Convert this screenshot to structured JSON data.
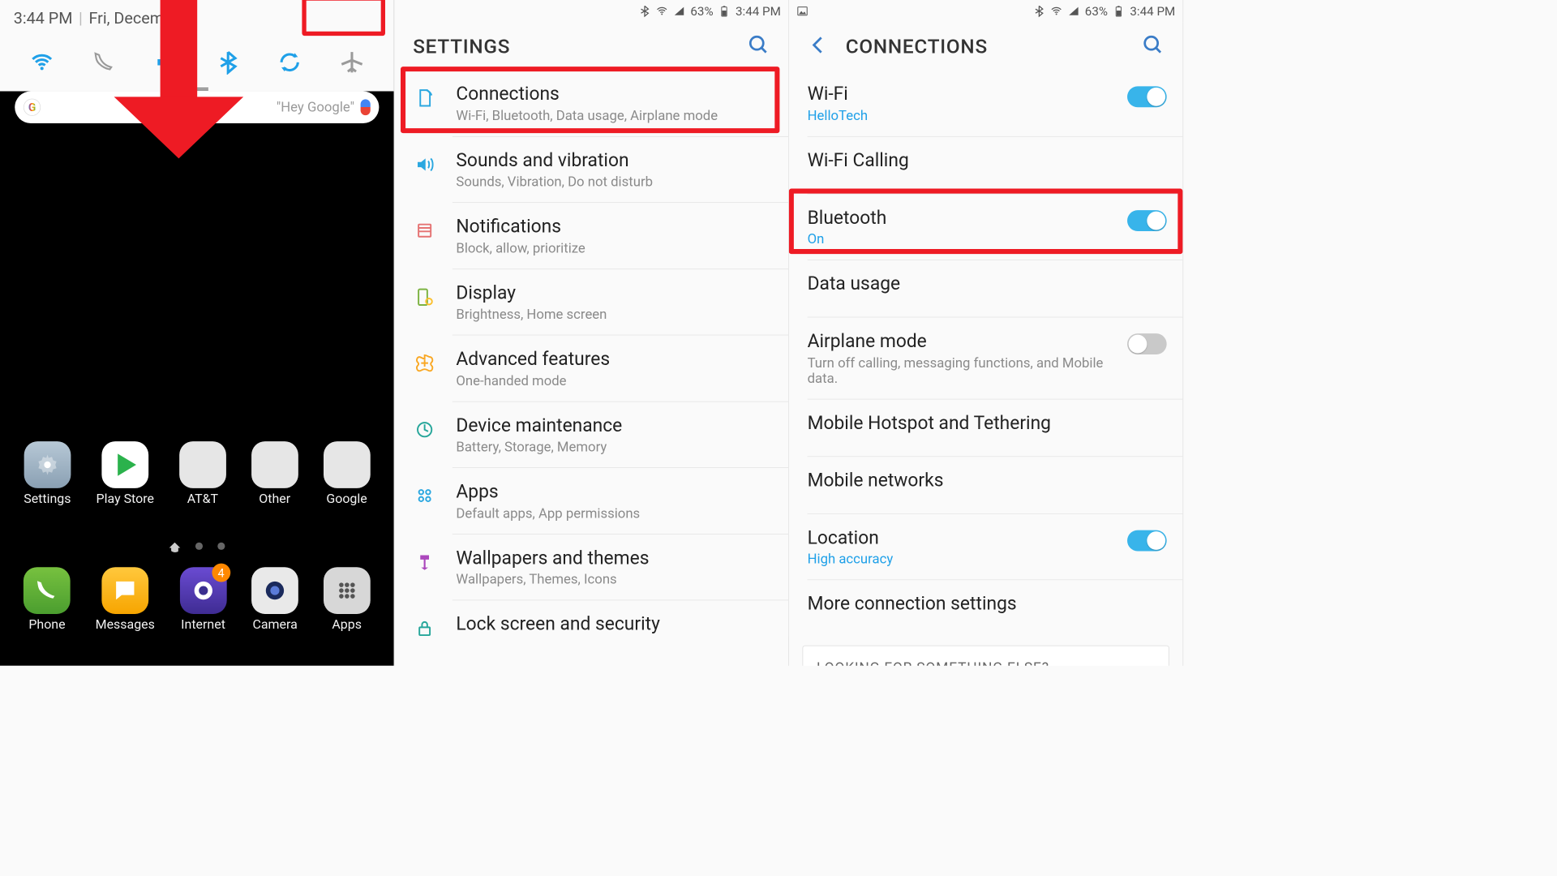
{
  "pane1": {
    "time": "3:44 PM",
    "date_prefix": "Fri, December",
    "search_hint": "\"Hey Google\"",
    "apps_row1": [
      {
        "label": "Settings"
      },
      {
        "label": "Play Store"
      },
      {
        "label": "AT&T"
      },
      {
        "label": "Other"
      },
      {
        "label": "Google"
      }
    ],
    "apps_row2": [
      {
        "label": "Phone"
      },
      {
        "label": "Messages"
      },
      {
        "label": "Internet",
        "badge": "4"
      },
      {
        "label": "Camera"
      },
      {
        "label": "Apps"
      }
    ]
  },
  "status": {
    "battery_pct": "63%",
    "time": "3:44 PM"
  },
  "settings": {
    "title": "SETTINGS",
    "items": [
      {
        "title": "Connections",
        "sub": "Wi-Fi, Bluetooth, Data usage, Airplane mode",
        "icon": "sim"
      },
      {
        "title": "Sounds and vibration",
        "sub": "Sounds, Vibration, Do not disturb",
        "icon": "sound"
      },
      {
        "title": "Notifications",
        "sub": "Block, allow, prioritize",
        "icon": "notif"
      },
      {
        "title": "Display",
        "sub": "Brightness, Home screen",
        "icon": "display"
      },
      {
        "title": "Advanced features",
        "sub": "One-handed mode",
        "icon": "adv"
      },
      {
        "title": "Device maintenance",
        "sub": "Battery, Storage, Memory",
        "icon": "maint"
      },
      {
        "title": "Apps",
        "sub": "Default apps, App permissions",
        "icon": "apps"
      },
      {
        "title": "Wallpapers and themes",
        "sub": "Wallpapers, Themes, Icons",
        "icon": "wall"
      },
      {
        "title": "Lock screen and security",
        "sub": "",
        "icon": "lock"
      }
    ]
  },
  "connections": {
    "title": "CONNECTIONS",
    "items": [
      {
        "title": "Wi-Fi",
        "sub": "HelloTech",
        "sub_blue": true,
        "toggle": true,
        "toggle_on": true
      },
      {
        "title": "Wi-Fi Calling"
      },
      {
        "title": "Bluetooth",
        "sub": "On",
        "sub_blue": true,
        "toggle": true,
        "toggle_on": true
      },
      {
        "title": "Data usage"
      },
      {
        "title": "Airplane mode",
        "sub": "Turn off calling, messaging functions, and Mobile data.",
        "toggle": true,
        "toggle_on": false
      },
      {
        "title": "Mobile Hotspot and Tethering"
      },
      {
        "title": "Mobile networks"
      },
      {
        "title": "Location",
        "sub": "High accuracy",
        "sub_blue": true,
        "toggle": true,
        "toggle_on": true
      },
      {
        "title": "More connection settings"
      }
    ],
    "footer": "LOOKING FOR SOMETHING ELSE?"
  }
}
